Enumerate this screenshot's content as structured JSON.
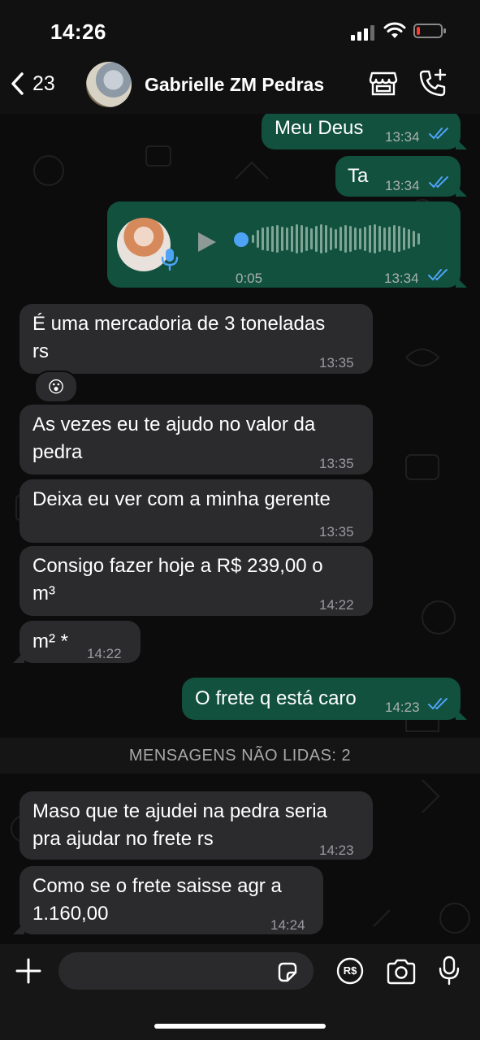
{
  "status_bar": {
    "time": "14:26",
    "battery_level": 0.15
  },
  "header": {
    "back_count": "23",
    "contact_name": "Gabrielle ZM Pedras",
    "icons": [
      "chevron-left-icon",
      "store-icon",
      "add-call-icon"
    ]
  },
  "colors": {
    "outgoing_bubble": "#11513e",
    "incoming_bubble": "#2b2b2e",
    "read_ticks": "#4fa3f7",
    "battery_low": "#ff3b30"
  },
  "messages": [
    {
      "dir": "out",
      "text": "Meu Deus",
      "time": "13:34",
      "status": "read"
    },
    {
      "dir": "out",
      "text": "Ta",
      "time": "13:34",
      "status": "read"
    },
    {
      "dir": "out",
      "type": "voice",
      "duration": "0:05",
      "time": "13:34",
      "status": "read"
    },
    {
      "dir": "in",
      "lines": [
        "É uma mercadoria de 3 toneladas",
        "rs"
      ],
      "time": "13:35",
      "reaction": "😮"
    },
    {
      "dir": "in",
      "lines": [
        "As vezes eu te ajudo no valor da",
        "pedra"
      ],
      "time": "13:35"
    },
    {
      "dir": "in",
      "text": "Deixa eu ver com a minha gerente",
      "time": "13:35"
    },
    {
      "dir": "in",
      "lines": [
        "Consigo fazer hoje a  R$ 239,00 o",
        "m³"
      ],
      "time": "14:22"
    },
    {
      "dir": "in",
      "text": "m² *",
      "time": "14:22"
    },
    {
      "dir": "out",
      "text": "O frete q está caro",
      "time": "14:23",
      "status": "read"
    },
    {
      "dir": "in",
      "lines": [
        "Maso que te ajudei na pedra seria",
        "pra ajudar no frete rs"
      ],
      "time": "14:23"
    },
    {
      "dir": "in",
      "lines": [
        "Como se o frete saisse agr a",
        "1.160,00"
      ],
      "time": "14:24"
    }
  ],
  "unread_divider": "MENSAGENS NÃO LIDAS: 2",
  "input_bar": {
    "icons": [
      "plus-icon",
      "sticker-icon",
      "pix-payment-icon",
      "camera-icon",
      "microphone-icon"
    ],
    "pix_label": "R$"
  }
}
